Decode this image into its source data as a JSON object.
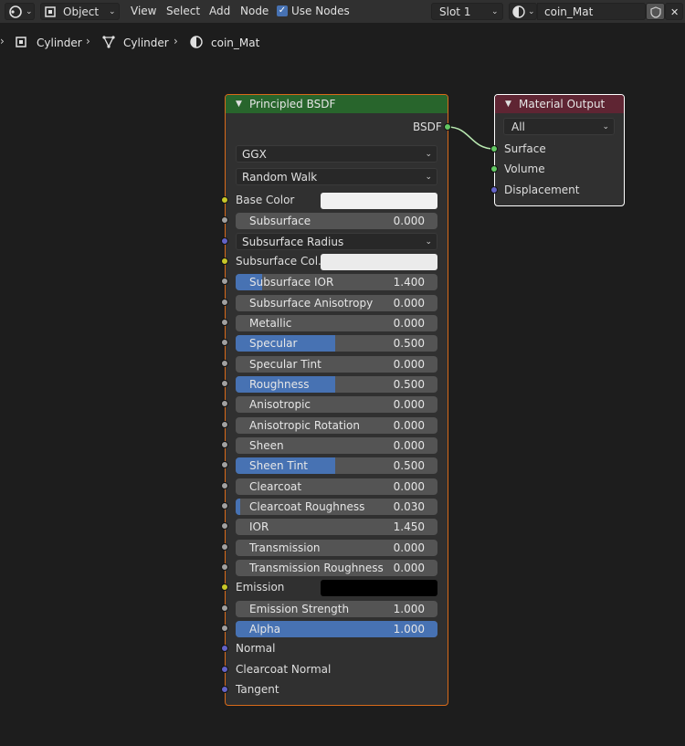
{
  "header": {
    "mode": "Object",
    "menus": [
      "View",
      "Select",
      "Add",
      "Node"
    ],
    "use_nodes_label": "Use Nodes",
    "slot": "Slot 1",
    "material": "coin_Mat"
  },
  "breadcrumb": [
    "Cylinder",
    "Cylinder",
    "coin_Mat"
  ],
  "bsdf": {
    "title": "Principled BSDF",
    "output_label": "BSDF",
    "distribution": "GGX",
    "subsurface_method": "Random Walk",
    "base_color_label": "Base Color",
    "base_color": "#f0f0f0",
    "subsurface_radius_label": "Subsurface Radius",
    "subsurface_color_label": "Subsurface Col...",
    "subsurface_color": "#ebebeb",
    "emission_label": "Emission",
    "emission_color": "#000000",
    "normal_label": "Normal",
    "clearcoat_normal_label": "Clearcoat Normal",
    "tangent_label": "Tangent",
    "sliders": [
      {
        "label": "Subsurface",
        "value": "0.000",
        "fill": 0
      },
      {
        "label": "Subsurface IOR",
        "value": "1.400",
        "fill": 0.13
      },
      {
        "label": "Subsurface Anisotropy",
        "value": "0.000",
        "fill": 0
      },
      {
        "label": "Metallic",
        "value": "0.000",
        "fill": 0
      },
      {
        "label": "Specular",
        "value": "0.500",
        "fill": 0.5
      },
      {
        "label": "Specular Tint",
        "value": "0.000",
        "fill": 0
      },
      {
        "label": "Roughness",
        "value": "0.500",
        "fill": 0.5
      },
      {
        "label": "Anisotropic",
        "value": "0.000",
        "fill": 0
      },
      {
        "label": "Anisotropic Rotation",
        "value": "0.000",
        "fill": 0
      },
      {
        "label": "Sheen",
        "value": "0.000",
        "fill": 0
      },
      {
        "label": "Sheen Tint",
        "value": "0.500",
        "fill": 0.5
      },
      {
        "label": "Clearcoat",
        "value": "0.000",
        "fill": 0
      },
      {
        "label": "Clearcoat Roughness",
        "value": "0.030",
        "fill": 0.03
      },
      {
        "label": "IOR",
        "value": "1.450",
        "fill": 0
      },
      {
        "label": "Transmission",
        "value": "0.000",
        "fill": 0
      },
      {
        "label": "Transmission Roughness",
        "value": "0.000",
        "fill": 0
      },
      {
        "label": "Emission Strength",
        "value": "1.000",
        "fill": 0
      },
      {
        "label": "Alpha",
        "value": "1.000",
        "fill": 1
      }
    ]
  },
  "output": {
    "title": "Material Output",
    "target": "All",
    "surface_label": "Surface",
    "volume_label": "Volume",
    "displacement_label": "Displacement"
  }
}
